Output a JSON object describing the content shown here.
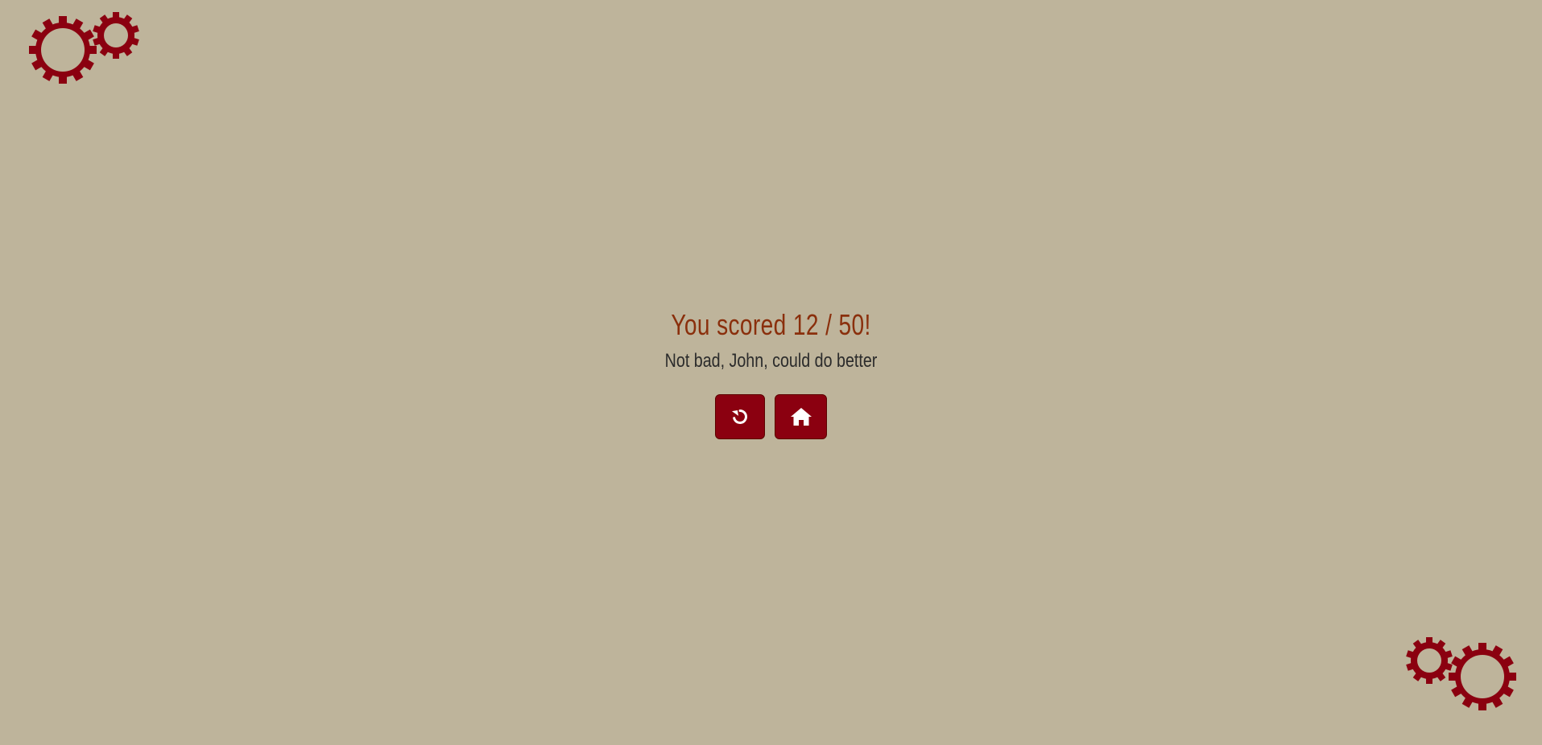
{
  "decorations": {
    "top_left_icon": "gears-icon",
    "bottom_right_icon": "gears-icon",
    "accent_color": "#8b0010"
  },
  "result": {
    "score": 12,
    "total": 50,
    "title": "You scored 12 / 50!",
    "message": "Not bad, John, could do better"
  },
  "actions": {
    "retry_icon": "redo-icon",
    "home_icon": "home-icon"
  },
  "colors": {
    "background": "#beb49b",
    "title": "#8a2f0c",
    "message": "#2b2b2b",
    "button": "#8b0010"
  }
}
